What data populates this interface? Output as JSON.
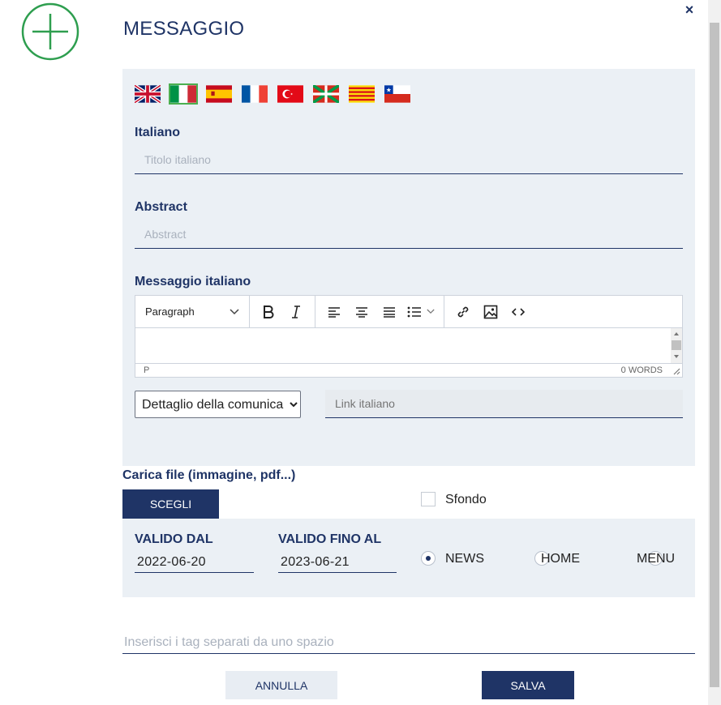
{
  "header": {
    "title": "MESSAGGIO",
    "close_label": "×"
  },
  "flags": [
    "flag-uk-icon",
    "flag-italy-icon",
    "flag-spain-icon",
    "flag-france-icon",
    "flag-turkey-icon",
    "flag-basque-icon",
    "flag-catalonia-icon",
    "flag-chile-icon"
  ],
  "form": {
    "italiano_label": "Italiano",
    "titolo_placeholder": "Titolo italiano",
    "abstract_label": "Abstract",
    "abstract_placeholder": "Abstract",
    "messaggio_label": "Messaggio italiano",
    "editor": {
      "paragraph": "Paragraph",
      "status_path": "P",
      "word_count": "0 WORDS"
    },
    "select_value": "Dettaglio della comunicazione",
    "link_placeholder": "Link italiano"
  },
  "upload": {
    "label": "Carica file (immagine, pdf...)",
    "choose_button": "SCEGLI",
    "sfondo_label": "Sfondo"
  },
  "validity": {
    "from_label": "VALIDO DAL",
    "from_value": "2022-06-20",
    "to_label": "VALIDO FINO AL",
    "to_value": "2023-06-21",
    "options": [
      {
        "label": "NEWS",
        "checked": true
      },
      {
        "label": "HOME",
        "checked": false
      },
      {
        "label": "MENU",
        "checked": false
      }
    ]
  },
  "tags_placeholder": "Inserisci i tag separati da uno spazio",
  "actions": {
    "cancel": "ANNULLA",
    "save": "SALVA"
  },
  "colors": {
    "primary": "#1f3466",
    "panel": "#ebf0f5",
    "accent_green": "#2e9e4f"
  }
}
